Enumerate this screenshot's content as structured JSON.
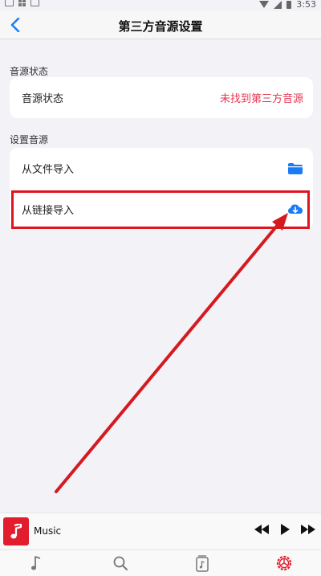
{
  "status_bar": {
    "time": "3:53"
  },
  "nav": {
    "title": "第三方音源设置"
  },
  "source_status": {
    "section_label": "音源状态",
    "row_label": "音源状态",
    "row_value": "未找到第三方音源"
  },
  "set_source": {
    "section_label": "设置音源",
    "items": [
      {
        "label": "从文件导入",
        "icon": "folder-icon"
      },
      {
        "label": "从链接导入",
        "icon": "cloud-download-icon"
      }
    ]
  },
  "player": {
    "title": "Music"
  },
  "tabs": [
    {
      "icon": "music-note-icon"
    },
    {
      "icon": "search-icon"
    },
    {
      "icon": "library-icon"
    },
    {
      "icon": "settings-gear-icon",
      "active": true
    }
  ],
  "colors": {
    "accent": "#1a7cf5",
    "danger": "#e8364f",
    "highlight": "#e0141e",
    "cover": "#e21d2d",
    "active_tab": "#e21d2d"
  }
}
